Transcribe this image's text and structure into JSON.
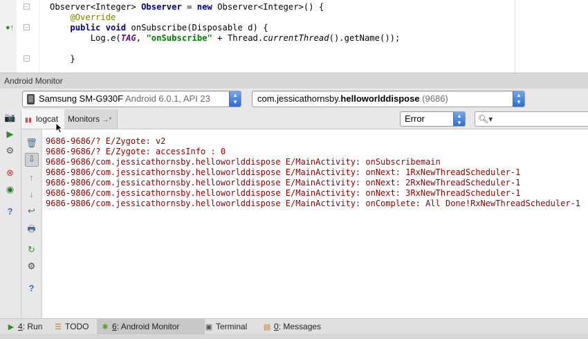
{
  "editor": {
    "lines": [
      {
        "segments": [
          {
            "t": "Observer<Integer> ",
            "c": ""
          },
          {
            "t": "Observer",
            "c": "kw"
          },
          {
            "t": " = ",
            "c": ""
          },
          {
            "t": "new",
            "c": "kw"
          },
          {
            "t": " Observer<Integer>() {",
            "c": ""
          }
        ]
      },
      {
        "segments": [
          {
            "t": "    @Override",
            "c": "ann"
          }
        ]
      },
      {
        "segments": [
          {
            "t": "    ",
            "c": ""
          },
          {
            "t": "public void",
            "c": "kw"
          },
          {
            "t": " onSubscribe(Disposable d) {",
            "c": ""
          }
        ]
      },
      {
        "segments": [
          {
            "t": "        Log.",
            "c": ""
          },
          {
            "t": "e",
            "c": "it"
          },
          {
            "t": "(",
            "c": ""
          },
          {
            "t": "TAG",
            "c": "fld"
          },
          {
            "t": ", ",
            "c": ""
          },
          {
            "t": "\"onSubscribe\"",
            "c": "str"
          },
          {
            "t": " + Thread.",
            "c": ""
          },
          {
            "t": "currentThread",
            "c": "it"
          },
          {
            "t": "().getName());",
            "c": ""
          }
        ]
      },
      {
        "segments": [
          {
            "t": "",
            "c": ""
          }
        ]
      },
      {
        "segments": [
          {
            "t": "    }",
            "c": ""
          }
        ]
      }
    ]
  },
  "monitor": {
    "title": "Android Monitor",
    "device": {
      "name": "Samsung SM-G930F",
      "detail": "Android 6.0.1, API 23"
    },
    "process": {
      "prefix": "com.jessicathornsby.",
      "bold": "helloworlddispose",
      "pid": "(9686)"
    },
    "tabs": {
      "logcat": "logcat",
      "monitors": "Monitors",
      "monitors_suffix": "→*"
    },
    "log_level": "Error",
    "search_placeholder": "",
    "log_lines": [
      "9686-9686/? E/Zygote: v2",
      "9686-9686/? E/Zygote: accessInfo : 0",
      "9686-9686/com.jessicathornsby.helloworlddispose E/MainActivity: onSubscribemain",
      "9686-9806/com.jessicathornsby.helloworlddispose E/MainActivity: onNext: 1RxNewThreadScheduler-1",
      "9686-9806/com.jessicathornsby.helloworlddispose E/MainActivity: onNext: 2RxNewThreadScheduler-1",
      "9686-9806/com.jessicathornsby.helloworlddispose E/MainActivity: onNext: 3RxNewThreadScheduler-1",
      "9686-9806/com.jessicathornsby.helloworlddispose E/MainActivity: onComplete: All Done!RxNewThreadScheduler-1"
    ],
    "log_color": "#8b0000"
  },
  "bottom_bar": {
    "run": {
      "key": "4",
      "label": ": Run"
    },
    "todo": {
      "label": "TODO"
    },
    "android_monitor": {
      "key": "6",
      "label": ": Android Monitor"
    },
    "terminal": {
      "label": "Terminal"
    },
    "messages": {
      "key": "0",
      "label": ": Messages"
    }
  }
}
